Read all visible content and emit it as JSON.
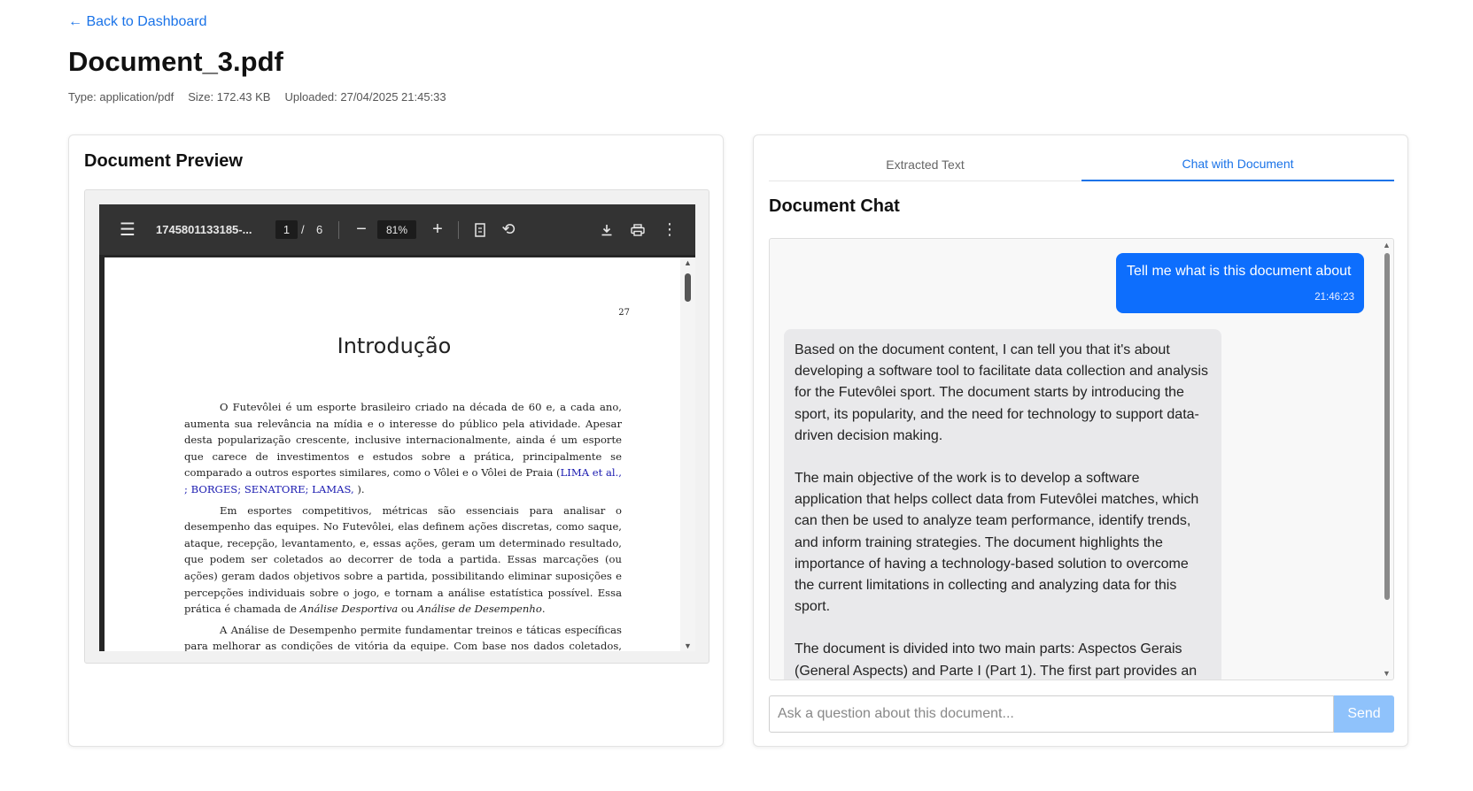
{
  "nav": {
    "back_label": "← Back to Dashboard"
  },
  "document": {
    "title": "Document_3.pdf",
    "type_label": "Type: application/pdf",
    "size_label": "Size: 172.43 KB",
    "uploaded_label": "Uploaded: 27/04/2025 21:45:33"
  },
  "preview": {
    "heading": "Document Preview",
    "viewer": {
      "filename": "1745801133185-...",
      "current_page": "1",
      "page_separator": "/",
      "total_pages": "6",
      "zoom": "81%"
    },
    "page": {
      "page_number": "27",
      "heading": "Introdução",
      "p1_text": "O Futevôlei é um esporte brasileiro criado na década de 60 e, a cada ano, aumenta sua relevância na mídia e o interesse do público pela atividade. Apesar desta popularização crescente, inclusive internacionalmente, ainda é um esporte que carece de investimentos e estudos sobre a prática, principalmente se comparado a outros esportes similares, como o Vôlei e o Vôlei de Praia (",
      "p1_cite": "LIMA et al., ; BORGES; SENATORE; LAMAS, ",
      "p1_end": ").",
      "p2_a": "Em esportes competitivos, métricas são essenciais para analisar o desempenho das equipes. No Futevôlei, elas definem ações discretas, como saque, ataque, recepção, levantamento, e, essas ações, geram um determinado resultado, que podem ser coletados ao decorrer de toda a partida. Essas marcações (ou ações) geram dados objetivos sobre a partida, possibilitando eliminar suposições e percepções individuais sobre o jogo, e tornam a análise estatística possível. Essa prática é chamada de ",
      "p2_em1": "Análise Desportiva",
      "p2_or": " ou ",
      "p2_em2": "Análise de Desempenho",
      "p2_end": ".",
      "p3_text": "A Análise de Desempenho permite fundamentar treinos e táticas específicas para melhorar as condições de vitória da equipe. Com base nos dados coletados, define-se"
    }
  },
  "chat_panel": {
    "tabs": [
      {
        "label": "Extracted Text",
        "active": false
      },
      {
        "label": "Chat with Document",
        "active": true
      }
    ],
    "heading": "Document Chat",
    "messages": {
      "user": {
        "text": "Tell me what is this document about",
        "time": "21:46:23"
      },
      "assistant": {
        "paragraphs": [
          "Based on the document content, I can tell you that it's about developing a software tool to facilitate data collection and analysis for the Futevôlei sport. The document starts by introducing the sport, its popularity, and the need for technology to support data-driven decision making.",
          "The main objective of the work is to develop a software application that helps collect data from Futevôlei matches, which can then be used to analyze team performance, identify trends, and inform training strategies. The document highlights the importance of having a technology-based solution to overcome the current limitations in collecting and analyzing data for this sport.",
          "The document is divided into two main parts: Aspectos Gerais (General Aspects) and Parte I (Part 1). The first part provides an"
        ]
      }
    },
    "input": {
      "placeholder": "Ask a question about this document...",
      "value": ""
    },
    "send_label": "Send"
  },
  "colors": {
    "accent": "#1a73e8",
    "user_bubble": "#0d6efd",
    "send_button": "#8fc2fb",
    "assistant_bubble": "#e9e9eb"
  },
  "icons": {
    "menu": "hamburger-icon",
    "zoom_out": "minus-icon",
    "zoom_in": "plus-icon",
    "fit": "fit-page-icon",
    "rotate": "rotate-icon",
    "download": "download-icon",
    "print": "print-icon",
    "more": "more-vertical-icon"
  }
}
